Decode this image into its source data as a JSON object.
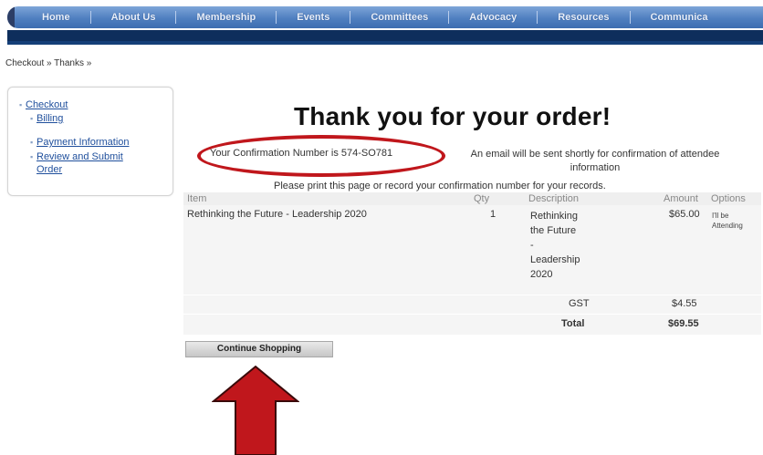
{
  "nav": {
    "items": [
      "Home",
      "About Us",
      "Membership",
      "Events",
      "Committees",
      "Advocacy",
      "Resources",
      "Communica"
    ]
  },
  "breadcrumb": "Checkout » Thanks »",
  "sidebar": {
    "items": [
      {
        "label": "Checkout"
      },
      {
        "label": "Billing"
      },
      {
        "label": "Payment Information"
      },
      {
        "label": "Review and Submit"
      },
      {
        "label": "Order"
      }
    ]
  },
  "main": {
    "heading": "Thank you for your order!",
    "confirmation_text": "Your Confirmation Number is 574-SO781",
    "email_notice_line1": "An email will be sent shortly for confirmation of attendee",
    "email_notice_line2": "information",
    "print_notice": "Please print this page or record your confirmation number for your records."
  },
  "table": {
    "headers": {
      "item": "Item",
      "qty": "Qty",
      "description": "Description",
      "amount": "Amount",
      "options": "Options"
    },
    "row": {
      "item": "Rethinking the Future - Leadership 2020",
      "qty": "1",
      "description_lines": [
        "Rethinking",
        "the Future",
        "-",
        "Leadership",
        "2020"
      ],
      "amount": "$65.00",
      "options_lines": [
        "I'll be",
        "Attending"
      ]
    },
    "gst": {
      "label": "GST",
      "amount": "$4.55"
    },
    "total": {
      "label": "Total",
      "amount": "$69.55"
    }
  },
  "continue_button": "Continue Shopping",
  "colors": {
    "nav_bar": "#4f7fc0",
    "nav_stripe": "#0e2e5c",
    "annotation_red": "#c0171c",
    "arrow_fill": "#c0171c"
  }
}
